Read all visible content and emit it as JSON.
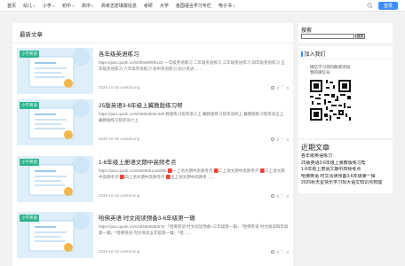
{
  "nav": {
    "items": [
      {
        "label": "首页",
        "dropdown": false
      },
      {
        "label": "幼儿",
        "dropdown": true
      },
      {
        "label": "小学",
        "dropdown": true
      },
      {
        "label": "初中",
        "dropdown": true
      },
      {
        "label": "高中",
        "dropdown": true
      },
      {
        "label": "高考志愿填报信息",
        "dropdown": false
      },
      {
        "label": "考研",
        "dropdown": false
      },
      {
        "label": "大学",
        "dropdown": false
      },
      {
        "label": "各国语言学习专栏",
        "dropdown": false
      },
      {
        "label": "电子书",
        "dropdown": true
      }
    ],
    "caret": "∨",
    "login_label": "登录"
  },
  "main": {
    "title": "最新文章",
    "posts": [
      {
        "tag": "小学英语",
        "title": "各年级英语练习",
        "desc": "https://pan.quark.cn/s/9f0e9bf8f6181 一年级英语练习 二年级英语练习 三年级英语练习 四年级英语练习 五年级英语练习 六年级英语练习 初中英语练习 幼小英语 ......",
        "date": "2025-10-16",
        "author": "xuekuhong",
        "views": "0",
        "likes": "0"
      },
      {
        "tag": "小学英语",
        "title": "25版英语3-6年级上冀教版练习帮",
        "desc": "https://pan.quark.cn/s/038b0605c3d9 教版练习帮英语三上 冀教版练习帮英语四上 冀教版练习帮英语五上 冀教版练习帮英语六上",
        "date": "2025-10-16",
        "author": "xuekuhong",
        "views": "0",
        "likes": "0"
      },
      {
        "tag": "小学英语",
        "title": "1-6年级上册语文期中高频考点",
        "desc": "https://pan.quark.cn/s/5835851ca0096 🟥一上语文期中高频考点 🟥二上语文期中高频考点 🟥三上语文期中高频考点 🟥四上语文期中高频考点 🟥五上语文期中高频考 ......",
        "date": "2025-10-16",
        "author": "xuekuhong",
        "views": "0",
        "likes": "0"
      },
      {
        "tag": "小学英语",
        "title": "哈佛英语 时文阅读预备3-6年级第一辑",
        "desc": "https://pan.quark.cn/s/284866555573 「哈佛英语 时文阅读预备+三年级第一辑」「哈佛英语 时文阅读四年级第一辑」「哈佛英语 时文阅读五年级第一辑」「哈 ......",
        "date": "2025-10-16",
        "author": "xuekuhong",
        "views": "0",
        "likes": "0"
      }
    ]
  },
  "sidebar": {
    "search_label": "搜索",
    "search_placeholder": "",
    "search_button": "搜索",
    "join_title": "加入我们",
    "join_text": [
      "微信学习资料群请添加",
      "我的微信号"
    ],
    "recent_title": "近期文章",
    "recent_items": [
      "各年级英语练习",
      "25版英语3-6年级上冀教版练习帮",
      "1-6年级上册语文期中高频考点",
      "哈佛英语 时文阅读预备3-6年级第一辑",
      "2025秋天星快乐学习现大语文知识点梳理"
    ]
  },
  "colors": {
    "accent": "#3f8cff",
    "tag": "#2bb48c",
    "thumb_bg": "#dfeff9"
  }
}
